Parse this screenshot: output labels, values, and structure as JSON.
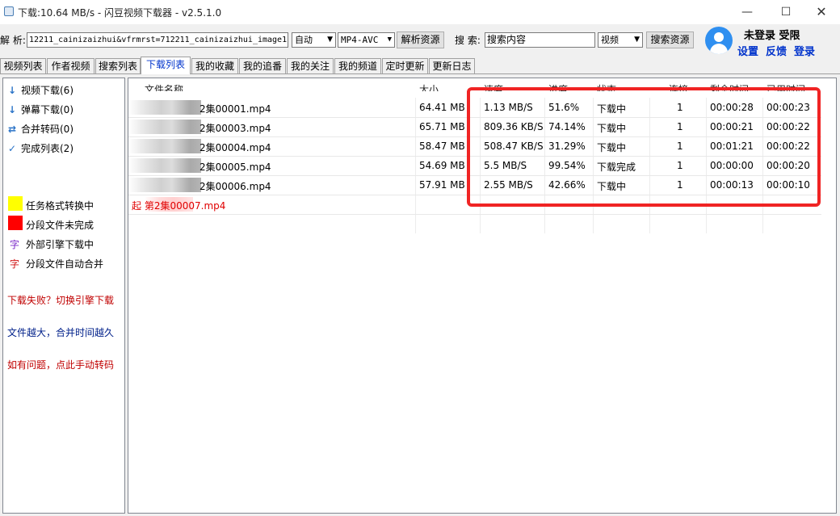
{
  "window": {
    "title": "下载:10.64 MB/s - 闪豆视频下载器 - v2.5.1.0",
    "minimize_glyph": "—",
    "maximize_glyph": "☐",
    "close_glyph": "✕"
  },
  "toolbar": {
    "parse_label": "解 析:",
    "url_value": "12211_cainizaizhui&vfrmrst=712211_cainizaizhui_image1",
    "quality_value": "自动",
    "format_value": "MP4-AVC",
    "parse_button": "解析资源",
    "search_label": "搜 索:",
    "search_value": "搜索内容",
    "search_type_value": "视频",
    "search_button": "搜索资源"
  },
  "user": {
    "status": "未登录 受限",
    "settings_link": "设置",
    "feedback_link": "反馈",
    "login_link": "登录"
  },
  "tabs": [
    "视频列表",
    "作者视频",
    "搜索列表",
    "下载列表",
    "我的收藏",
    "我的追番",
    "我的关注",
    "我的频道",
    "定时更新",
    "更新日志"
  ],
  "sidebar": {
    "items": [
      {
        "icon": "↓",
        "label": "视频下载(6)"
      },
      {
        "icon": "↓",
        "label": "弹幕下载(0)"
      },
      {
        "icon": "⇄",
        "label": "合并转码(0)"
      },
      {
        "icon": "✓",
        "label": "完成列表(2)"
      }
    ],
    "legend": [
      {
        "color": "#ffff00",
        "label": "任务格式转换中"
      },
      {
        "color": "#ff0000",
        "label": "分段文件未完成"
      },
      {
        "char": "字",
        "char_color": "#7a28c8",
        "label": "外部引擎下载中"
      },
      {
        "char": "字",
        "char_color": "#d01010",
        "label": "分段文件自动合并"
      }
    ],
    "notes": [
      {
        "text": "下载失败？切换引擎下载",
        "color": "#c00000"
      },
      {
        "text": "文件越大，合并时间越久",
        "color": "#00208a"
      },
      {
        "text": "如有问题，点此手动转码",
        "color": "#c00000"
      }
    ]
  },
  "table": {
    "columns": [
      "文件名称",
      "大小",
      "速度",
      "进度",
      "状态",
      "连接",
      "剩余时间",
      "已用时间"
    ],
    "rows": [
      {
        "name": "2集00001.mp4",
        "size": "64.41 MB",
        "speed": "1.13 MB/S",
        "progress": "51.6%",
        "status": "下载中",
        "conn": "1",
        "remaining": "00:00:28",
        "elapsed": "00:00:23"
      },
      {
        "name": "2集00003.mp4",
        "size": "65.71 MB",
        "speed": "809.36 KB/S",
        "progress": "74.14%",
        "status": "下载中",
        "conn": "1",
        "remaining": "00:00:21",
        "elapsed": "00:00:22"
      },
      {
        "name": "2集00004.mp4",
        "size": "58.47 MB",
        "speed": "508.47 KB/S",
        "progress": "31.29%",
        "status": "下载中",
        "conn": "1",
        "remaining": "00:01:21",
        "elapsed": "00:00:22"
      },
      {
        "name": "2集00005.mp4",
        "size": "54.69 MB",
        "speed": "5.5 MB/S",
        "progress": "99.54%",
        "status": "下载完成",
        "conn": "1",
        "remaining": "00:00:00",
        "elapsed": "00:00:20"
      },
      {
        "name": "2集00006.mp4",
        "size": "57.91 MB",
        "speed": "2.55 MB/S",
        "progress": "42.66%",
        "status": "下载中",
        "conn": "1",
        "remaining": "00:00:13",
        "elapsed": "00:00:10"
      },
      {
        "name": "起 第2集00007.mp4",
        "size": "",
        "speed": "",
        "progress": "",
        "status": "",
        "conn": "",
        "remaining": "",
        "elapsed": "",
        "red": true
      }
    ]
  },
  "colors": {
    "accent": "#0033cc",
    "highlight": "#f02424",
    "error_row": "#e00000"
  }
}
